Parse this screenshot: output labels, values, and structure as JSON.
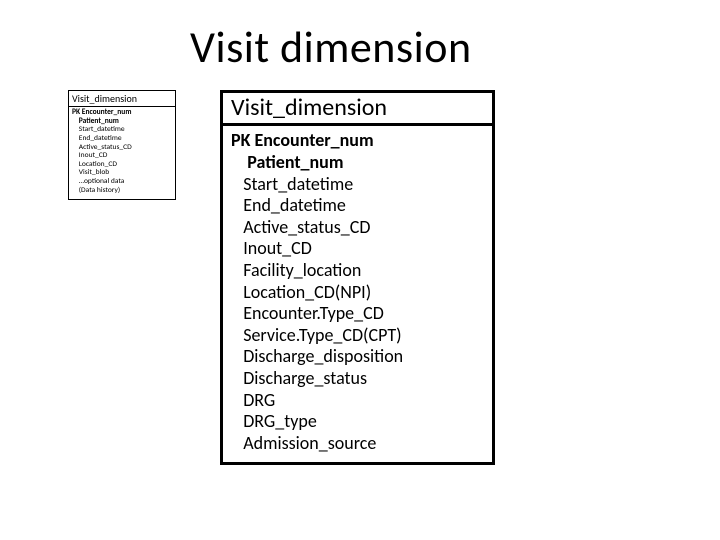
{
  "title": "Visit dimension",
  "small_table": {
    "name": "Visit_dimension",
    "rows": [
      {
        "text": "PK Encounter_num",
        "bold": true
      },
      {
        "text": "    Patient_num",
        "bold": true
      },
      {
        "text": "    Start_datetime",
        "bold": false
      },
      {
        "text": "    End_datetime",
        "bold": false
      },
      {
        "text": "    Active_status_CD",
        "bold": false
      },
      {
        "text": "    Inout_CD",
        "bold": false
      },
      {
        "text": "    Location_CD",
        "bold": false
      },
      {
        "text": "    Visit_blob",
        "bold": false
      },
      {
        "text": "    …optional data",
        "bold": false
      },
      {
        "text": "    (Data history)",
        "bold": false
      }
    ]
  },
  "big_table": {
    "name": "Visit_dimension",
    "rows": [
      {
        "text": "PK Encounter_num",
        "bold": true
      },
      {
        "text": "    Patient_num",
        "bold": true
      },
      {
        "text": "   Start_datetime",
        "bold": false
      },
      {
        "text": "   End_datetime",
        "bold": false
      },
      {
        "text": "   Active_status_CD",
        "bold": false
      },
      {
        "text": "   Inout_CD",
        "bold": false
      },
      {
        "text": "   Facility_location",
        "bold": false
      },
      {
        "text": "   Location_CD(NPI)",
        "bold": false
      },
      {
        "text": "   Encounter.Type_CD",
        "bold": false
      },
      {
        "text": "   Service.Type_CD(CPT)",
        "bold": false
      },
      {
        "text": "   Discharge_disposition",
        "bold": false
      },
      {
        "text": "   Discharge_status",
        "bold": false
      },
      {
        "text": "   DRG",
        "bold": false
      },
      {
        "text": "   DRG_type",
        "bold": false
      },
      {
        "text": "   Admission_source",
        "bold": false
      }
    ]
  }
}
